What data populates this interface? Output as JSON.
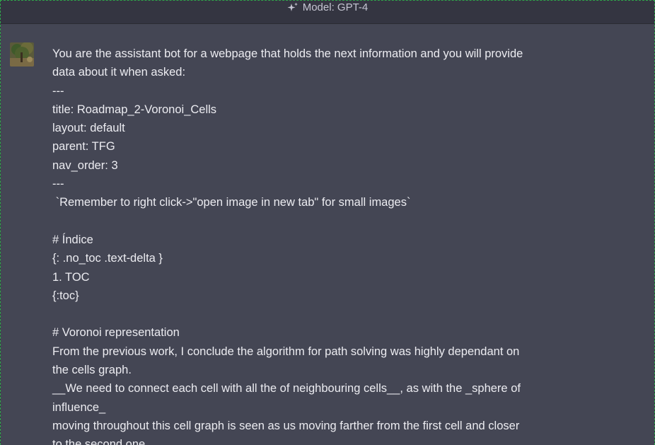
{
  "header": {
    "model_label": "Model: GPT-4"
  },
  "message": {
    "lines": [
      "You are the assistant bot for a webpage that holds the next information and you will provide",
      "data about it when asked:",
      "---",
      "title: Roadmap_2-Voronoi_Cells",
      "layout: default",
      "parent: TFG",
      "nav_order: 3",
      "---",
      " `Remember to right click->\"open image in new tab\" for small images`",
      "",
      "# Índice",
      "{: .no_toc .text-delta }",
      "1. TOC",
      "{:toc}",
      "",
      "# Voronoi representation",
      "From the previous work, I conclude the algorithm for path solving was highly dependant on",
      "the cells graph.",
      "__We need to connect each cell with all the of neighbouring cells__, as with the _sphere of",
      "influence_",
      "moving throughout this cell graph is seen as us moving farther from the first cell and closer",
      "to the second one."
    ]
  },
  "icons": {
    "model": "sparkle-icon",
    "avatar": "user-avatar"
  },
  "colors": {
    "page_bg": "#343541",
    "message_bg": "#444654",
    "text": "#ececf1",
    "header_text": "#c5c5d2"
  }
}
